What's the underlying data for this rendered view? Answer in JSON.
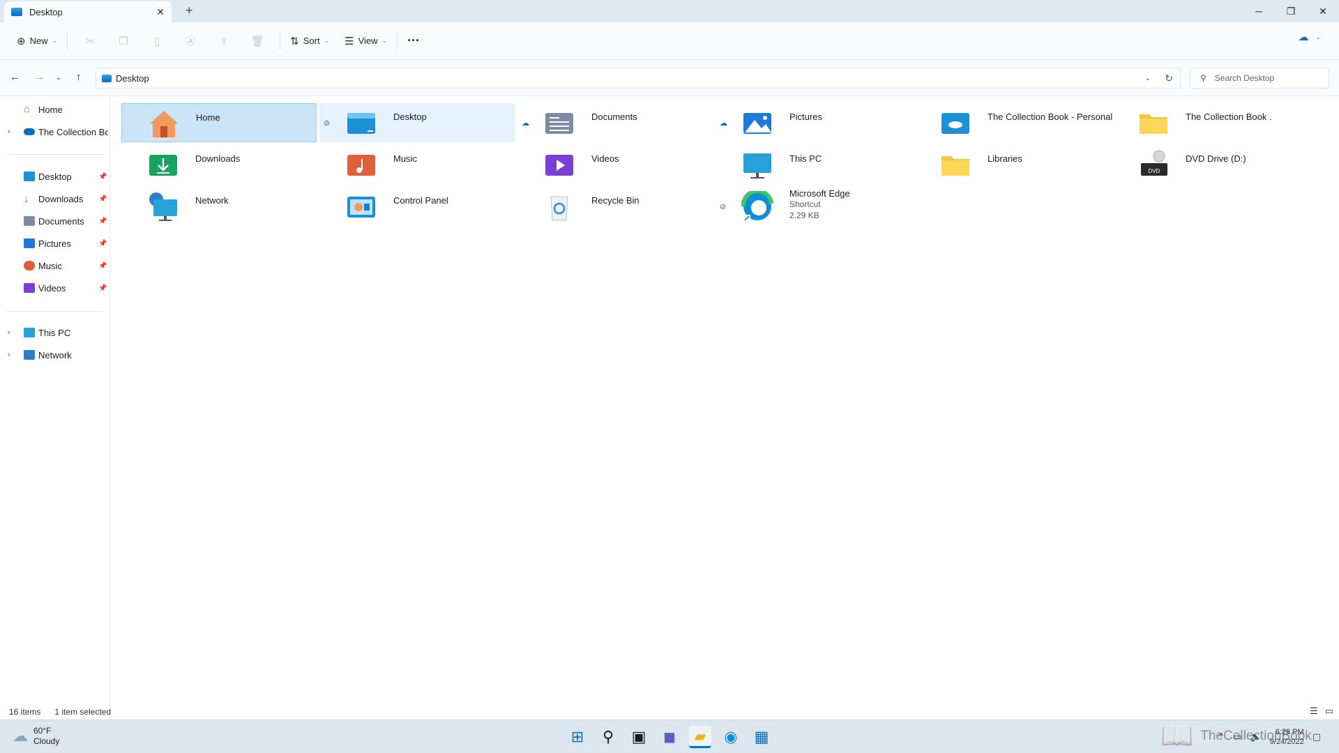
{
  "window": {
    "tab_title": "Desktop",
    "close_tab": "✕",
    "new_tab": "+",
    "minimize": "─",
    "maximize": "❐",
    "close": "✕"
  },
  "toolbar": {
    "new_label": "New",
    "sort_label": "Sort",
    "view_label": "View",
    "more_label": "···"
  },
  "address": {
    "path": "Desktop",
    "search_placeholder": "Search Desktop"
  },
  "sidebar": {
    "home": "Home",
    "onedrive": "The Collection Boo",
    "pinned": [
      {
        "label": "Desktop",
        "color": "#1e90d6"
      },
      {
        "label": "Downloads",
        "color": "#1aa260"
      },
      {
        "label": "Documents",
        "color": "#7c8ba1"
      },
      {
        "label": "Pictures",
        "color": "#1e7ad6"
      },
      {
        "label": "Music",
        "color": "#e0603a"
      },
      {
        "label": "Videos",
        "color": "#7b3fd6"
      }
    ],
    "this_pc": "This PC",
    "network": "Network"
  },
  "items": [
    {
      "name": "Home",
      "icon": "home-icon"
    },
    {
      "name": "Desktop",
      "icon": "desktop-icon"
    },
    {
      "name": "Documents",
      "icon": "documents-icon"
    },
    {
      "name": "Pictures",
      "icon": "pictures-icon"
    },
    {
      "name": "The Collection Book - Personal",
      "icon": "onedrive-folder-icon"
    },
    {
      "name": "The Collection Book .",
      "icon": "folder-icon"
    },
    {
      "name": "Downloads",
      "icon": "downloads-icon"
    },
    {
      "name": "Music",
      "icon": "music-icon"
    },
    {
      "name": "Videos",
      "icon": "videos-icon"
    },
    {
      "name": "This PC",
      "icon": "this-pc-icon"
    },
    {
      "name": "Libraries",
      "icon": "libraries-icon"
    },
    {
      "name": "DVD Drive (D:)",
      "icon": "dvd-drive-icon",
      "badge": "DVD"
    },
    {
      "name": "Network",
      "icon": "network-icon"
    },
    {
      "name": "Control Panel",
      "icon": "control-panel-icon"
    },
    {
      "name": "Recycle Bin",
      "icon": "recycle-bin-icon"
    },
    {
      "name": "Microsoft Edge",
      "icon": "edge-icon",
      "type": "Shortcut",
      "size": "2.29 KB"
    }
  ],
  "status": {
    "count": "16 items",
    "selection": "1 item selected"
  },
  "taskbar": {
    "temperature": "60°F",
    "condition": "Cloudy",
    "time": "6:28 PM",
    "date": "9/24/2022"
  },
  "watermark": "TheCollectionBook"
}
